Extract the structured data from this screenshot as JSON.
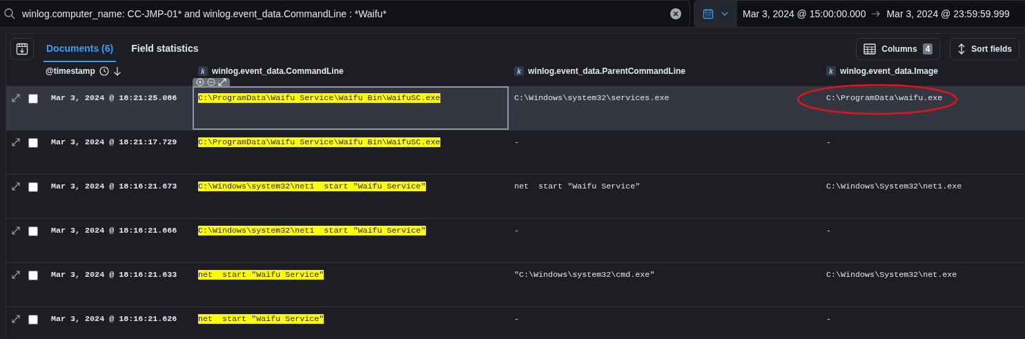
{
  "query": {
    "text": "winlog.computer_name: CC-JMP-01* and winlog.event_data.CommandLine : *Waifu*"
  },
  "date_range": {
    "start": "Mar 3, 2024 @ 15:00:00.000",
    "end": "Mar 3, 2024 @ 23:59:59.999"
  },
  "tabs": [
    {
      "label": "Documents (6)",
      "selected": true
    },
    {
      "label": "Field statistics",
      "selected": false
    }
  ],
  "toolbar": {
    "columns_label": "Columns",
    "columns_count": "4",
    "sort_label": "Sort fields"
  },
  "table": {
    "columns": [
      {
        "name": "@timestamp",
        "kind": "date",
        "highlighted": false
      },
      {
        "name": "winlog.event_data.CommandLine",
        "kind": "keyword",
        "type_badge": "k",
        "highlighted": true
      },
      {
        "name": "winlog.event_data.ParentCommandLine",
        "kind": "keyword",
        "type_badge": "k",
        "highlighted": false
      },
      {
        "name": "winlog.event_data.Image",
        "kind": "keyword",
        "type_badge": "k",
        "highlighted": false
      }
    ],
    "rows": [
      {
        "selected": true,
        "checked": false,
        "focused": true,
        "image_circled": true,
        "cells": [
          "Mar 3, 2024 @ 18:21:25.086",
          "C:\\ProgramData\\Waifu Service\\Waifu Bin\\WaifuSC.exe",
          "C:\\Windows\\system32\\services.exe",
          "C:\\ProgramData\\waifu.exe"
        ]
      },
      {
        "selected": false,
        "checked": false,
        "focused": false,
        "image_circled": false,
        "cells": [
          "Mar 3, 2024 @ 18:21:17.729",
          "C:\\ProgramData\\Waifu Service\\Waifu Bin\\WaifuSC.exe",
          "-",
          "-"
        ]
      },
      {
        "selected": false,
        "checked": false,
        "focused": false,
        "image_circled": false,
        "cells": [
          "Mar 3, 2024 @ 18:16:21.673",
          "C:\\Windows\\system32\\net1  start \"Waifu Service\"",
          "net  start \"Waifu Service\"",
          "C:\\Windows\\System32\\net1.exe"
        ]
      },
      {
        "selected": false,
        "checked": false,
        "focused": false,
        "image_circled": false,
        "cells": [
          "Mar 3, 2024 @ 18:16:21.666",
          "C:\\Windows\\system32\\net1  start \"Waifu Service\"",
          "-",
          "-"
        ]
      },
      {
        "selected": false,
        "checked": false,
        "focused": false,
        "image_circled": false,
        "cells": [
          "Mar 3, 2024 @ 18:16:21.633",
          "net  start \"Waifu Service\"",
          "\"C:\\Windows\\system32\\cmd.exe\"",
          "C:\\Windows\\System32\\net.exe"
        ]
      },
      {
        "selected": false,
        "checked": false,
        "focused": false,
        "image_circled": false,
        "cells": [
          "Mar 3, 2024 @ 18:16:21.626",
          "net  start \"Waifu Service\"",
          "-",
          "-"
        ]
      }
    ]
  }
}
